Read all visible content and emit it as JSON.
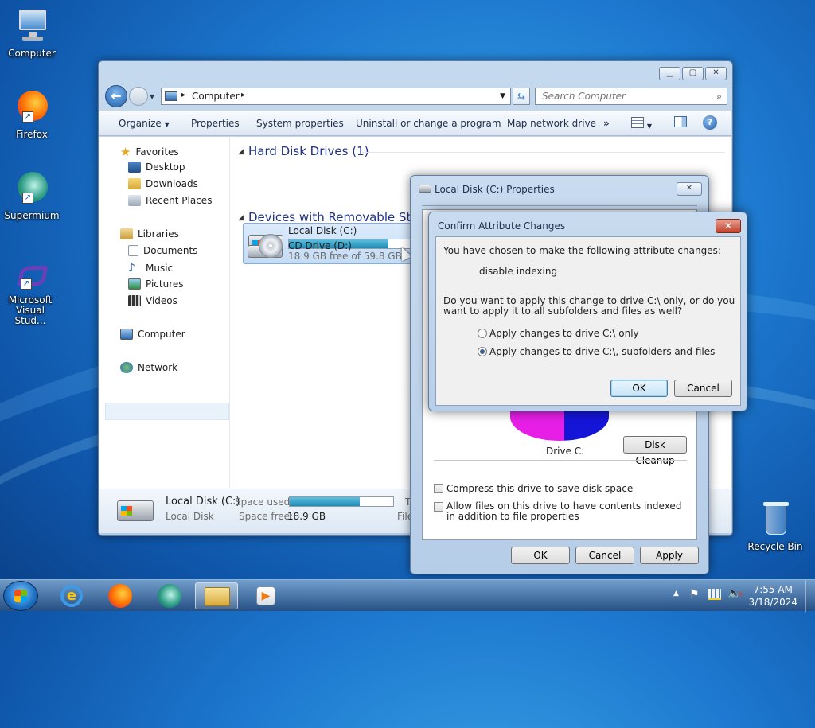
{
  "desktop": {
    "icons": [
      {
        "label": "Computer"
      },
      {
        "label": "Firefox"
      },
      {
        "label": "Supermium"
      },
      {
        "label": "Microsoft Visual Stud..."
      },
      {
        "label": "Recycle Bin"
      }
    ]
  },
  "explorer": {
    "address": {
      "crumb": "Computer"
    },
    "search": {
      "placeholder": "Search Computer"
    },
    "toolbar": {
      "organize": "Organize",
      "properties": "Properties",
      "system_properties": "System properties",
      "uninstall": "Uninstall or change a program",
      "map_drive": "Map network drive",
      "more": "»"
    },
    "nav": {
      "favorites": "Favorites",
      "desktop": "Desktop",
      "downloads": "Downloads",
      "recent": "Recent Places",
      "libraries": "Libraries",
      "documents": "Documents",
      "music": "Music",
      "pictures": "Pictures",
      "videos": "Videos",
      "computer": "Computer",
      "network": "Network"
    },
    "groups": {
      "hdd": "Hard Disk Drives (1)",
      "removable": "Devices with Removable Storag"
    },
    "local_disk": {
      "name": "Local Disk (C:)",
      "free": "18.9 GB free of 59.8 GB",
      "used_fraction": 0.68
    },
    "cd_drive": {
      "name": "CD Drive (D:)"
    },
    "status": {
      "name": "Local Disk (C:)",
      "type": "Local Disk",
      "space_used_label": "Space used:",
      "space_free_label": "Space free:",
      "space_free": "18.9 GB",
      "used_fraction": 0.68,
      "trunc1": "T",
      "trunc2": "File"
    }
  },
  "properties": {
    "title": "Local Disk (C:) Properties",
    "drive_label": "Drive C:",
    "disk_cleanup": "Disk Cleanup",
    "compress": "Compress this drive to save disk space",
    "index": "Allow files on this drive to have contents indexed in addition to file properties",
    "ok": "OK",
    "cancel": "Cancel",
    "apply": "Apply"
  },
  "confirm": {
    "title": "Confirm Attribute Changes",
    "intro": "You have chosen to make the following attribute changes:",
    "change": "disable indexing",
    "question": "Do you want to apply this change to drive C:\\ only, or do you want to apply it to all subfolders and files as well?",
    "option1": "Apply changes to drive C:\\ only",
    "option2": "Apply changes to drive C:\\, subfolders and files",
    "selected": 2,
    "ok": "OK",
    "cancel": "Cancel"
  },
  "taskbar": {
    "time": "7:55 AM",
    "date": "3/18/2024"
  }
}
